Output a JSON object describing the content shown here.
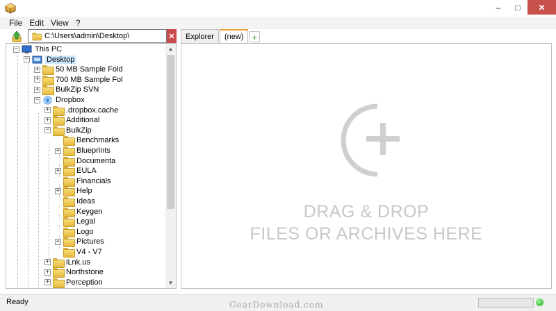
{
  "window": {
    "min_glyph": "–",
    "max_glyph": "□",
    "close_glyph": "✕"
  },
  "menu": [
    "File",
    "Edit",
    "View",
    "?"
  ],
  "path": {
    "value": "C:\\Users\\admin\\Desktop\\",
    "clear_glyph": "✕"
  },
  "tree": {
    "items": [
      {
        "label": "This PC",
        "level": 0,
        "expander": "−",
        "icon": "computer-icon"
      },
      {
        "label": "Desktop",
        "level": 1,
        "expander": "−",
        "icon": "desktop-folder-icon",
        "selected": true
      },
      {
        "label": "50 MB Sample Fold",
        "level": 2,
        "expander": "+",
        "icon": "folder-icon"
      },
      {
        "label": "700 MB Sample Fol",
        "level": 2,
        "expander": "+",
        "icon": "folder-icon"
      },
      {
        "label": "BulkZip SVN",
        "level": 2,
        "expander": "+",
        "icon": "folder-icon"
      },
      {
        "label": "Dropbox",
        "level": 2,
        "expander": "−",
        "icon": "dropbox-icon"
      },
      {
        "label": ".dropbox.cache",
        "level": 3,
        "expander": "+",
        "icon": "folder-icon"
      },
      {
        "label": "Additional",
        "level": 3,
        "expander": "+",
        "icon": "folder-icon"
      },
      {
        "label": "BulkZip",
        "level": 3,
        "expander": "−",
        "icon": "folder-icon"
      },
      {
        "label": "Benchmarks",
        "level": 4,
        "expander": "",
        "icon": "folder-icon"
      },
      {
        "label": "Blueprints",
        "level": 4,
        "expander": "+",
        "icon": "folder-icon"
      },
      {
        "label": "Documenta",
        "level": 4,
        "expander": "",
        "icon": "folder-icon"
      },
      {
        "label": "EULA",
        "level": 4,
        "expander": "+",
        "icon": "folder-icon"
      },
      {
        "label": "Financials",
        "level": 4,
        "expander": "",
        "icon": "folder-icon"
      },
      {
        "label": "Help",
        "level": 4,
        "expander": "+",
        "icon": "folder-icon"
      },
      {
        "label": "Ideas",
        "level": 4,
        "expander": "",
        "icon": "folder-icon"
      },
      {
        "label": "Keygen",
        "level": 4,
        "expander": "",
        "icon": "folder-icon"
      },
      {
        "label": "Legal",
        "level": 4,
        "expander": "",
        "icon": "folder-icon"
      },
      {
        "label": "Logo",
        "level": 4,
        "expander": "",
        "icon": "folder-icon"
      },
      {
        "label": "Pictures",
        "level": 4,
        "expander": "+",
        "icon": "folder-icon"
      },
      {
        "label": "V4 - V7",
        "level": 4,
        "expander": "",
        "icon": "folder-icon"
      },
      {
        "label": "iLnk.us",
        "level": 3,
        "expander": "+",
        "icon": "folder-icon"
      },
      {
        "label": "Northstone",
        "level": 3,
        "expander": "+",
        "icon": "folder-icon"
      },
      {
        "label": "Perception",
        "level": 3,
        "expander": "+",
        "icon": "folder-icon"
      },
      {
        "label": "",
        "level": 3,
        "expander": "+",
        "icon": "folder-icon"
      }
    ]
  },
  "tabs": [
    {
      "label": "Explorer",
      "active": false
    },
    {
      "label": "(new)",
      "active": true
    }
  ],
  "tab_add_glyph": "+",
  "drop": {
    "line1": "DRAG & DROP",
    "line2": "FILES OR ARCHIVES HERE"
  },
  "status": {
    "text": "Ready",
    "led_color": "#1aa31a"
  },
  "watermark": "GearDownload.com",
  "colors": {
    "accent_tab": "#f0a33a",
    "close_button": "#c7504b",
    "path_clear": "#c94a4a",
    "drop_text": "#c8c8c8"
  }
}
